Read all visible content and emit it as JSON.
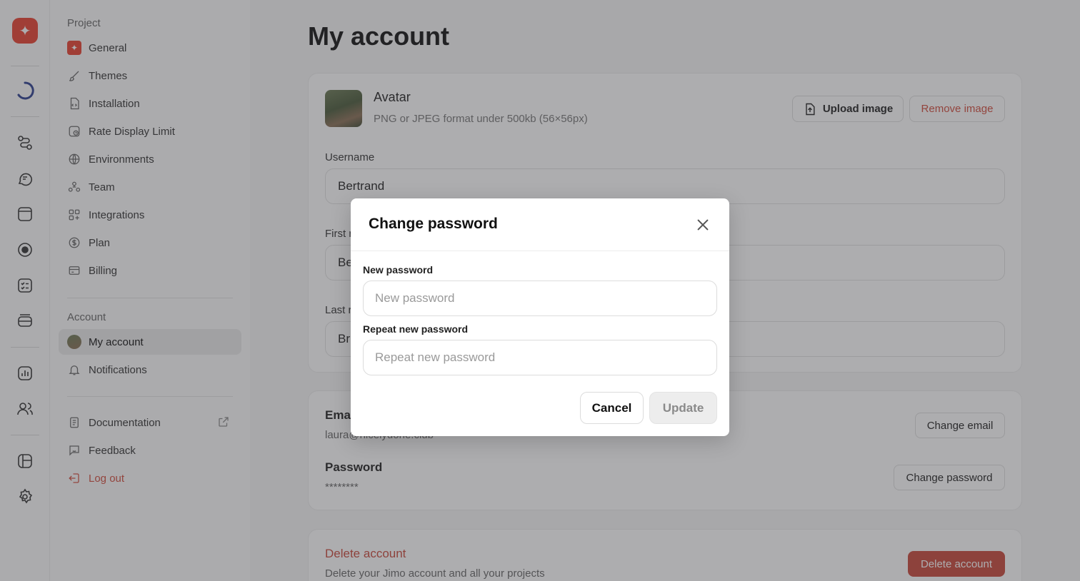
{
  "rail": {
    "icons": [
      "logo-icon",
      "loader-icon",
      "flows-icon",
      "chat-icon",
      "window-icon",
      "target-icon",
      "checklist-icon",
      "stack-icon",
      "analytics-icon",
      "users-icon",
      "layout-icon",
      "settings-icon"
    ]
  },
  "sidebar": {
    "project_label": "Project",
    "project_items": [
      {
        "label": "General",
        "icon": "logo-icon"
      },
      {
        "label": "Themes",
        "icon": "brush-icon"
      },
      {
        "label": "Installation",
        "icon": "code-file-icon"
      },
      {
        "label": "Rate Display Limit",
        "icon": "timer-icon"
      },
      {
        "label": "Environments",
        "icon": "globe-icon"
      },
      {
        "label": "Team",
        "icon": "team-icon"
      },
      {
        "label": "Integrations",
        "icon": "grid-plus-icon"
      },
      {
        "label": "Plan",
        "icon": "dollar-icon"
      },
      {
        "label": "Billing",
        "icon": "card-icon"
      }
    ],
    "account_label": "Account",
    "account_items": [
      {
        "label": "My account",
        "icon": "avatar-icon"
      },
      {
        "label": "Notifications",
        "icon": "bell-icon"
      }
    ],
    "footer_items": [
      {
        "label": "Documentation",
        "icon": "document-icon"
      },
      {
        "label": "Feedback",
        "icon": "feedback-icon"
      },
      {
        "label": "Log out",
        "icon": "logout-icon"
      }
    ]
  },
  "main": {
    "title": "My account",
    "avatar": {
      "title": "Avatar",
      "subtitle": "PNG or JPEG format under 500kb (56×56px)",
      "upload_label": "Upload image",
      "remove_label": "Remove image"
    },
    "username_label": "Username",
    "username_value": "Bertrand",
    "firstname_label_partial": "First r",
    "firstname_value_partial": "Be",
    "lastname_label_partial": "Last r",
    "lastname_value_partial": "Br",
    "email_title_partial": "Ema",
    "email_value_partial": "laura@nicelydone.club",
    "change_email_label": "Change email",
    "password_title": "Password",
    "password_value": "********",
    "change_password_label": "Change password",
    "delete_title": "Delete account",
    "delete_sub": "Delete your Jimo account and all your projects",
    "delete_button_label": "Delete account"
  },
  "modal": {
    "title": "Change password",
    "new_label": "New password",
    "new_placeholder": "New password",
    "repeat_label": "Repeat new password",
    "repeat_placeholder": "Repeat new password",
    "cancel_label": "Cancel",
    "update_label": "Update"
  },
  "colors": {
    "brand": "#e8402f",
    "danger": "#c9473a",
    "overlay": "rgba(60,60,65,0.42)"
  }
}
